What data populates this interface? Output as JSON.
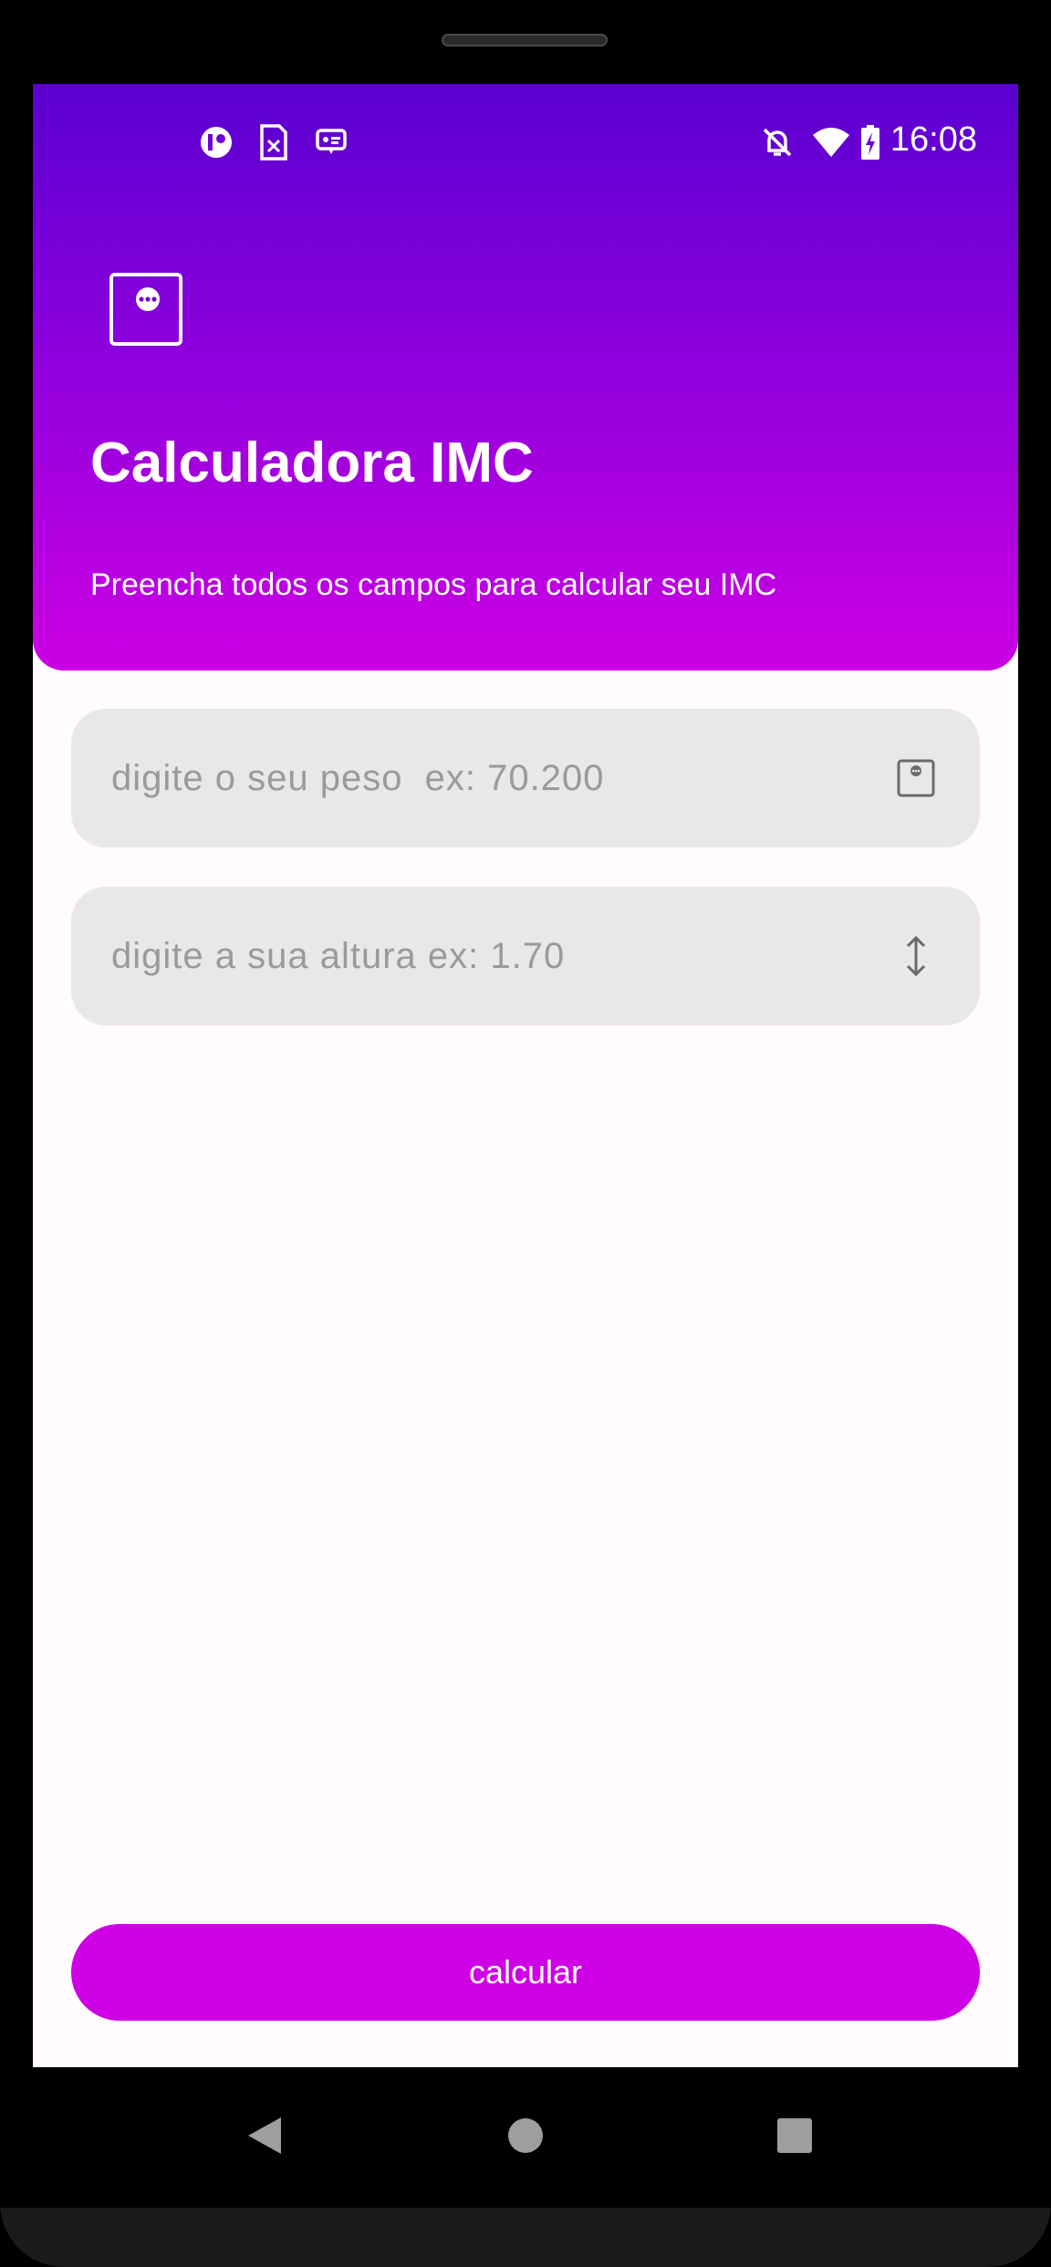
{
  "status_bar": {
    "time": "16:08",
    "left_icons": [
      "app-status-icon",
      "sim-card-icon",
      "message-icon"
    ],
    "right_icons": [
      "notifications-off-icon",
      "wifi-icon",
      "battery-charging-icon"
    ]
  },
  "header": {
    "app_icon": "scale-icon",
    "title": "Calculadora IMC",
    "subtitle": "Preencha todos os campos para calcular seu IMC",
    "gradient_top": "#5a00d0",
    "gradient_bottom": "#cc00e4"
  },
  "form": {
    "weight": {
      "value": "",
      "placeholder": "digite o seu peso  ex: 70.200",
      "icon": "scale-icon"
    },
    "height": {
      "value": "",
      "placeholder": "digite a sua altura ex: 1.70",
      "icon": "height-arrows-icon"
    }
  },
  "actions": {
    "calculate_label": "calcular",
    "button_color": "#d000e6"
  },
  "nav_bar": {
    "buttons": [
      "back-icon",
      "home-icon",
      "recents-icon"
    ]
  }
}
